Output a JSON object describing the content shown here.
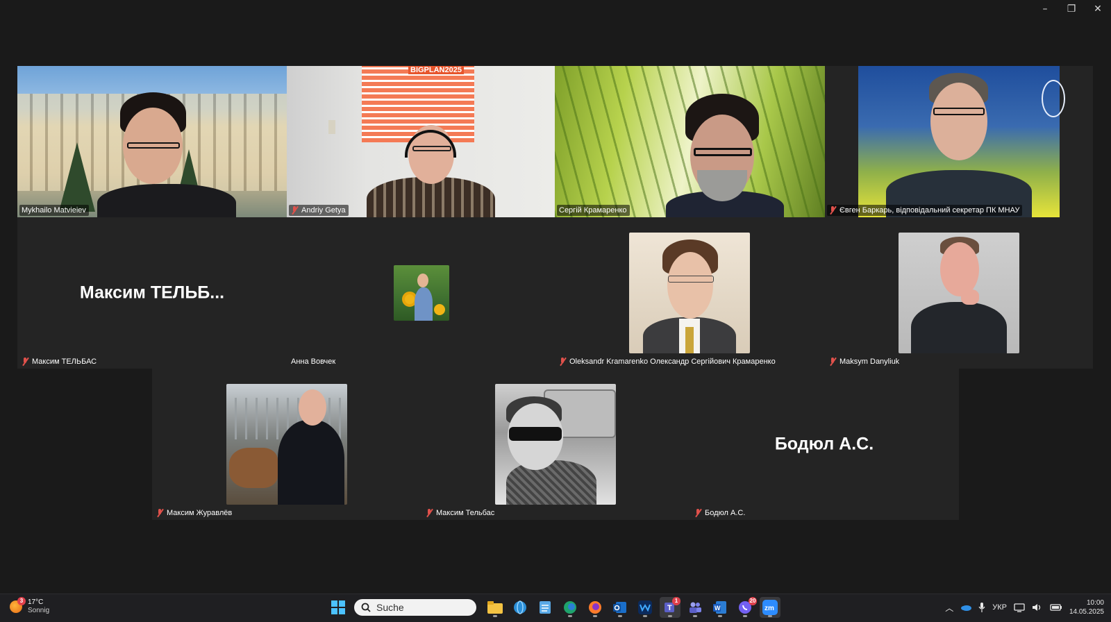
{
  "window_controls": {
    "minimize": "–",
    "restore": "❐",
    "close": "✕"
  },
  "participants": {
    "p1": {
      "name": "Mykhailo Matvieiev"
    },
    "p2": {
      "name": "Andriy Getya",
      "poster_text": "BIGPLAN2025"
    },
    "p3": {
      "name": "Сергій Крамаренко"
    },
    "p4": {
      "name": "Євген Баркарь, відповідальний секретар ПК МНАУ"
    },
    "p5": {
      "name": "Максим ТЕЛЬБАС",
      "display_text": "Максим  ТЕЛЬБ..."
    },
    "p6": {
      "name": "Анна Вовчек"
    },
    "p7": {
      "name": "Oleksandr Kramarenko Олександр Сергійович Крамаренко"
    },
    "p8": {
      "name": "Maksym Danyliuk"
    },
    "p9": {
      "name": "Максим Журавлёв"
    },
    "p10": {
      "name": "Максим Тельбас"
    },
    "p11": {
      "name": "Бодюл А.С.",
      "display_text": "Бодюл А.С."
    }
  },
  "taskbar": {
    "weather": {
      "temp": "17°C",
      "condition": "Sonnig",
      "badge": "3"
    },
    "search_placeholder": "Suche",
    "teams_badge": "1",
    "viber_badge": "20",
    "language": "УКР",
    "time": "10:00",
    "date": "14.05.2025"
  }
}
